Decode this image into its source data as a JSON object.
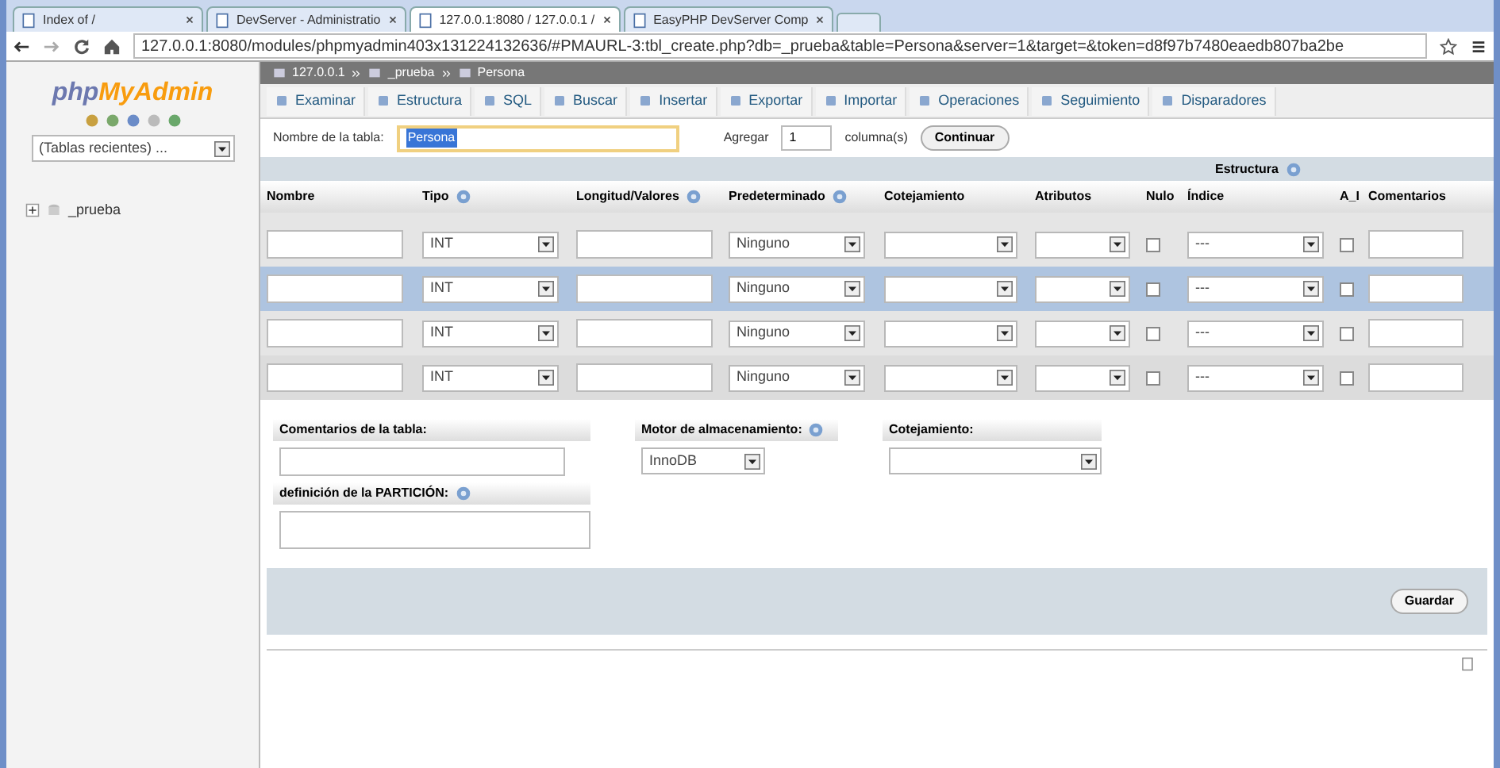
{
  "browser": {
    "tabs": [
      {
        "title": "Index of /",
        "selected": false
      },
      {
        "title": "DevServer - Administratio",
        "selected": false
      },
      {
        "title": "127.0.0.1:8080 / 127.0.0.1 /",
        "selected": true
      },
      {
        "title": "EasyPHP DevServer Comp",
        "selected": false
      }
    ],
    "address": "127.0.0.1:8080/modules/phpmyadmin403x131224132636/#PMAURL-3:tbl_create.php?db=_prueba&table=Persona&server=1&target=&token=d8f97b7480eaedb807ba2be"
  },
  "sidebar": {
    "logo_php": "php",
    "logo_rest": "MyAdmin",
    "recent": "(Tablas recientes) ...",
    "tree": [
      {
        "label": "_prueba",
        "expanded": false
      }
    ]
  },
  "breadcrumb": [
    "127.0.0.1",
    "_prueba",
    "Persona"
  ],
  "menu": [
    {
      "label": "Examinar"
    },
    {
      "label": "Estructura"
    },
    {
      "label": "SQL"
    },
    {
      "label": "Buscar"
    },
    {
      "label": "Insertar"
    },
    {
      "label": "Exportar"
    },
    {
      "label": "Importar"
    },
    {
      "label": "Operaciones"
    },
    {
      "label": "Seguimiento"
    },
    {
      "label": "Disparadores"
    }
  ],
  "table_name": {
    "label": "Nombre de la tabla:",
    "value": "Persona",
    "add_label": "Agregar",
    "add_value": "1",
    "columns_label": "columna(s)",
    "button": "Continuar"
  },
  "structure": {
    "group": "Estructura",
    "columns": [
      {
        "label": "Nombre",
        "help": false
      },
      {
        "label": "Tipo",
        "help": true
      },
      {
        "label": "Longitud/Valores",
        "help": true
      },
      {
        "label": "Predeterminado",
        "help": true
      },
      {
        "label": "Cotejamiento",
        "help": false
      },
      {
        "label": "Atributos",
        "help": false
      },
      {
        "label": "Nulo",
        "help": false
      },
      {
        "label": "Índice",
        "help": false
      },
      {
        "label": "A_I",
        "help": false
      },
      {
        "label": "Comentarios",
        "help": false
      }
    ],
    "rows": [
      {
        "type": "INT",
        "default": "Ninguno",
        "index": "---",
        "null": false,
        "ai": false,
        "highlighted": false
      },
      {
        "type": "INT",
        "default": "Ninguno",
        "index": "---",
        "null": false,
        "ai": false,
        "highlighted": true
      },
      {
        "type": "INT",
        "default": "Ninguno",
        "index": "---",
        "null": false,
        "ai": false,
        "highlighted": false
      },
      {
        "type": "INT",
        "default": "Ninguno",
        "index": "---",
        "null": false,
        "ai": false,
        "highlighted": false
      }
    ]
  },
  "options": {
    "comments_label": "Comentarios de la tabla:",
    "engine_label": "Motor de almacenamiento:",
    "engine_value": "InnoDB",
    "collation_label": "Cotejamiento:",
    "partition_label": "definición de la PARTICIÓN:"
  },
  "save_button": "Guardar"
}
